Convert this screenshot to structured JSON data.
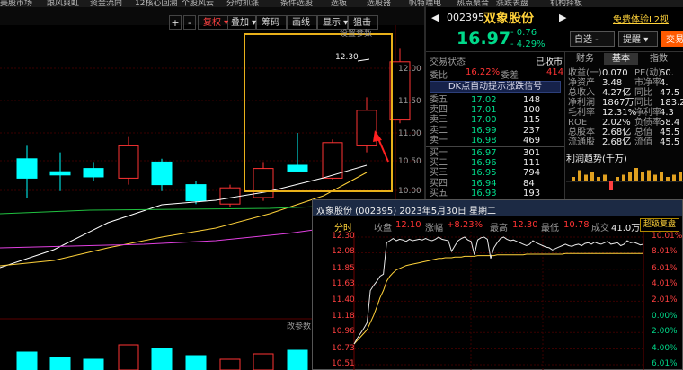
{
  "colors": {
    "up": "#ff3333",
    "down": "#00ffff",
    "accent": "#ffd23a",
    "green": "#00d98a"
  },
  "topbar": {
    "items": [
      "美股市场",
      "跟风爽虹",
      "资金流向",
      "12核心回溯",
      "个股风云",
      "分时抓涨",
      "条件选股",
      "选板",
      "选股器",
      "帆特端电",
      "热点聚合",
      "涨跌表盘",
      "机构择板"
    ]
  },
  "toolbar": {
    "plus": "+",
    "minus": "-",
    "fq": "复权 ▾",
    "overlay": "叠加 ▾",
    "chips": "筹码",
    "draw": "画线",
    "display": "显示 ▾",
    "snipe": "狙击"
  },
  "kline": {
    "settings_label": "设置参数",
    "settings_label2": "改参数",
    "high_label": "12.30",
    "yaxis": [
      "12.00",
      "11.50",
      "11.00",
      "10.50",
      "10.00"
    ],
    "candles": [
      {
        "o": 10.6,
        "c": 10.3,
        "h": 10.8,
        "l": 10.0
      },
      {
        "o": 10.4,
        "c": 10.35,
        "h": 10.7,
        "l": 10.1
      },
      {
        "o": 10.45,
        "c": 10.32,
        "h": 10.55,
        "l": 10.25
      },
      {
        "o": 10.3,
        "c": 10.8,
        "h": 10.95,
        "l": 10.2
      },
      {
        "o": 10.55,
        "c": 10.2,
        "h": 10.6,
        "l": 10.1
      },
      {
        "o": 10.2,
        "c": 9.95,
        "h": 10.25,
        "l": 9.9
      },
      {
        "o": 9.9,
        "c": 10.15,
        "h": 10.2,
        "l": 9.85
      },
      {
        "o": 10.0,
        "c": 10.45,
        "h": 10.55,
        "l": 9.95
      },
      {
        "o": 10.5,
        "c": 10.41,
        "h": 11.0,
        "l": 10.4
      },
      {
        "o": 10.3,
        "c": 10.85,
        "h": 10.9,
        "l": 10.28
      },
      {
        "o": 10.8,
        "c": 11.35,
        "h": 11.55,
        "l": 10.7
      },
      {
        "o": 11.2,
        "c": 12.1,
        "h": 12.3,
        "l": 11.15
      }
    ]
  },
  "quote": {
    "code": "002395",
    "name": "双象股份",
    "notice": "免费体验L2视",
    "price": "16.97",
    "change": "- 0.76",
    "change_pct": "- 4.29%",
    "btn_selfselect": "自选 -",
    "btn_remind": "提醒",
    "btn_trade": "交易",
    "status_label": "交易状态",
    "status_value": "已收市",
    "weibi_label": "委比",
    "weibi_value": "16.22%",
    "weicha_label": "委差",
    "weicha_value": "414",
    "signal_banner": "DK点自动提示涨跌信号",
    "asks": [
      {
        "label": "委五",
        "price": "17.02",
        "vol": "148"
      },
      {
        "label": "卖四",
        "price": "17.01",
        "vol": "100"
      },
      {
        "label": "卖三",
        "price": "17.00",
        "vol": "115"
      },
      {
        "label": "卖二",
        "price": "16.99",
        "vol": "237"
      },
      {
        "label": "卖一",
        "price": "16.98",
        "vol": "469"
      }
    ],
    "bids": [
      {
        "label": "买一",
        "price": "16.97",
        "vol": "301"
      },
      {
        "label": "买二",
        "price": "16.96",
        "vol": "111"
      },
      {
        "label": "买三",
        "price": "16.95",
        "vol": "794"
      },
      {
        "label": "买四",
        "price": "16.94",
        "vol": "84"
      },
      {
        "label": "买五",
        "price": "16.93",
        "vol": "193"
      }
    ]
  },
  "far_right": {
    "tabs": [
      "财务",
      "基本",
      "指数"
    ],
    "rows": [
      {
        "l1": "收益(一)",
        "v1": "0.070",
        "l2": "PE(动)",
        "v2": "60."
      },
      {
        "l1": "净资产",
        "v1": "3.48",
        "l2": "市净率",
        "v2": "4."
      },
      {
        "l1": "总收入",
        "v1": "4.27亿",
        "l2": "同比",
        "v2": "47.5"
      },
      {
        "l1": "净利润",
        "v1": "1867万",
        "l2": "同比",
        "v2": "183.2"
      },
      {
        "l1": "毛利率",
        "v1": "12.31%",
        "l2": "净利率",
        "v2": "4.3"
      },
      {
        "l1": "ROE",
        "v1": "2.02%",
        "l2": "负债率",
        "v2": "58.4"
      },
      {
        "l1": "总股本",
        "v1": "2.68亿",
        "l2": "总值",
        "v2": "45.5"
      },
      {
        "l1": "流通股",
        "v1": "2.68亿",
        "l2": "流值",
        "v2": "45.5"
      }
    ],
    "profit_title": "利润趋势(千万)",
    "profit_bars": [
      2,
      5,
      3,
      4,
      2,
      3,
      -4,
      2,
      3,
      4,
      6,
      4,
      5,
      3,
      4,
      2,
      3,
      4
    ]
  },
  "intraday": {
    "title": "双象股份 (002395)  2023年5月30日 星期二",
    "tab": "分时",
    "info": {
      "close_label": "收盘",
      "close": "12.10",
      "chg_label": "涨幅",
      "chg": "+8.23%",
      "high_label": "最高",
      "high": "12.30",
      "low_label": "最低",
      "low": "10.78",
      "vol_label": "成交",
      "vol": "41.0万"
    },
    "btn": "超级复盘",
    "y_left": [
      "12.30",
      "12.08",
      "11.85",
      "11.63",
      "11.40",
      "11.18",
      "10.96",
      "10.73",
      "10.51"
    ],
    "y_right": [
      "10.01%",
      "8.01%",
      "6.01%",
      "4.01%",
      "2.01%",
      "0.00%",
      "2.00%",
      "4.00%",
      "6.01%"
    ],
    "price_series": [
      10.8,
      10.88,
      10.95,
      11.02,
      11.1,
      11.55,
      11.62,
      11.68,
      11.75,
      11.78,
      12.22,
      12.25,
      12.28,
      12.25,
      12.27,
      12.26,
      12.24,
      12.27,
      12.25,
      12.26,
      12.27,
      12.26,
      12.28,
      12.26,
      12.25,
      12.27,
      12.3,
      12.27,
      12.26,
      12.25,
      12.1,
      12.18,
      12.25,
      12.28,
      12.3,
      12.26,
      12.24,
      12.05,
      12.26,
      12.29,
      12.3,
      12.27,
      12.0,
      12.15,
      12.22,
      12.28,
      12.3,
      12.27,
      12.25,
      12.26,
      12.24,
      12.22,
      12.2,
      12.18,
      12.2,
      12.25,
      12.22,
      12.2,
      12.18,
      12.16,
      12.15,
      12.12,
      12.14,
      12.16,
      12.18,
      12.2,
      12.18,
      12.17,
      12.19,
      12.2,
      12.18,
      12.21,
      12.22,
      12.2,
      12.23,
      12.21,
      12.2,
      12.22,
      12.24,
      12.2,
      12.21,
      12.22,
      12.18,
      12.2,
      12.25,
      12.22,
      12.23,
      12.21,
      12.19,
      12.2
    ],
    "avg_series": [
      10.8,
      10.85,
      10.9,
      10.95,
      11.0,
      11.1,
      11.2,
      11.32,
      11.45,
      11.55,
      11.68,
      11.75,
      11.8,
      11.84,
      11.86,
      11.88,
      11.9,
      11.91,
      11.92,
      11.93,
      11.94,
      11.95,
      11.96,
      11.97,
      11.98,
      11.99,
      12.0,
      12.0,
      12.01,
      12.01,
      12.01,
      12.02,
      12.02,
      12.02,
      12.03,
      12.03,
      12.03,
      12.03,
      12.04,
      12.04,
      12.04,
      12.04,
      12.04,
      12.04,
      12.05,
      12.05,
      12.05,
      12.05,
      12.05,
      12.05,
      12.05,
      12.05,
      12.05,
      12.06,
      12.06,
      12.06,
      12.06,
      12.06,
      12.06,
      12.06,
      12.06,
      12.06,
      12.06,
      12.06,
      12.06,
      12.07,
      12.07,
      12.07,
      12.07,
      12.07,
      12.07,
      12.07,
      12.07,
      12.07,
      12.07,
      12.07,
      12.07,
      12.07,
      12.07,
      12.07,
      12.07,
      12.07,
      12.07,
      12.07,
      12.07,
      12.07,
      12.07,
      12.07,
      12.07,
      12.07
    ]
  }
}
